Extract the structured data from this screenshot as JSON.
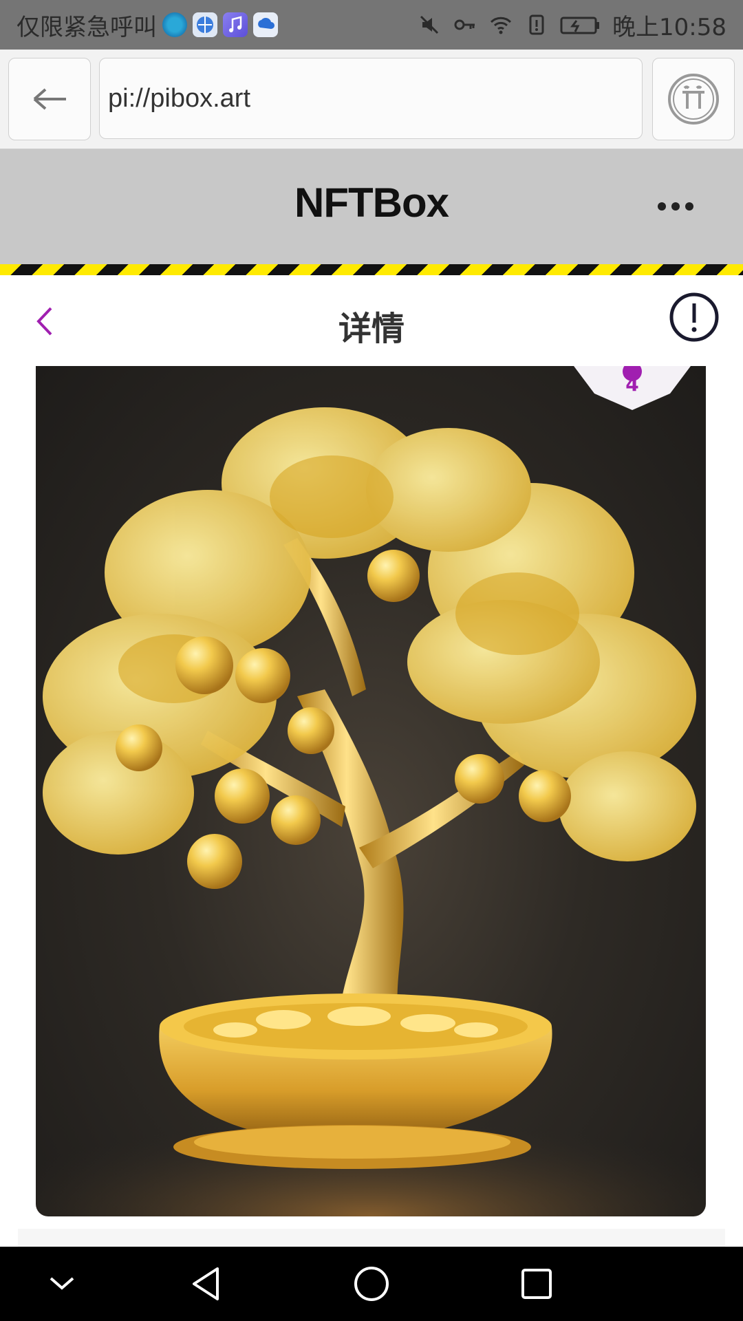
{
  "status_bar": {
    "carrier_text": "仅限紧急呼叫",
    "time": "晚上10:58",
    "notification_icons": [
      "browser-app-icon",
      "globe-app-icon",
      "music-app-icon",
      "cloud-app-icon"
    ],
    "system_icons": [
      "mute-icon",
      "key-icon",
      "wifi-icon",
      "alert-icon",
      "battery-icon"
    ]
  },
  "browser": {
    "url": "pi://pibox.art",
    "back_icon": "arrow-left-icon",
    "pi_icon": "pi-logo-icon"
  },
  "app_header": {
    "title": "NFTBox",
    "menu_icon": "more-horizontal-icon"
  },
  "page_header": {
    "title": "详情",
    "back_icon": "chevron-left-icon",
    "info_icon": "exclamation-circle-icon"
  },
  "nft": {
    "image_description_icon": "golden-money-tree-image",
    "badge_count": "4"
  },
  "nav_bar": {
    "icons": [
      "hide-keyboard-icon",
      "back-triangle-icon",
      "home-circle-icon",
      "recents-square-icon"
    ]
  },
  "colors": {
    "accent": "#a01fb0",
    "app_header_bg": "#c8c8c8",
    "status_bar_bg": "#757575",
    "stripe_yellow": "#ffea00"
  }
}
